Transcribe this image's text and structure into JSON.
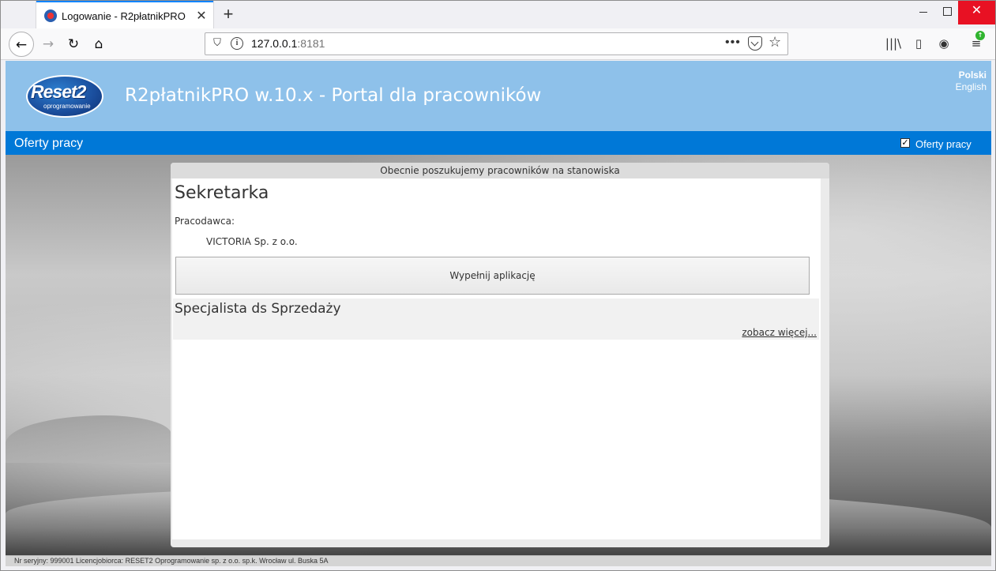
{
  "browser": {
    "tab_title": "Logowanie - R2płatnikPRO",
    "tab_close": "✕",
    "new_tab": "+",
    "close": "✕",
    "url_host": "127.0.0.1",
    "url_port": ":8181",
    "url_more": "•••",
    "star": "☆",
    "back": "←",
    "forward": "→",
    "reload": "↻",
    "home": "⌂",
    "shield": "⛉",
    "info": "i",
    "library": "|||\\",
    "sidebar": "▯",
    "account": "◉",
    "menu": "≡",
    "update": "↑"
  },
  "header": {
    "logo_text": "Reset2",
    "logo_sub": "oprogramowanie",
    "title": "R2płatnikPRO w.10.x - Portal dla pracowników",
    "lang_pl": "Polski",
    "lang_en": "English"
  },
  "menubar": {
    "title": "Oferty pracy",
    "checkbox_label": "Oferty pracy",
    "checkbox_mark": "✓"
  },
  "panel": {
    "heading": "Obecnie poszukujemy pracowników na stanowiska",
    "job1": {
      "title": "Sekretarka",
      "employer_label": "Pracodawca:",
      "employer_name": "VICTORIA Sp. z o.o.",
      "apply_label": "Wypełnij aplikację"
    },
    "job2": {
      "title": "Specjalista ds Sprzedaży",
      "more_label": "zobacz więcej..."
    }
  },
  "footer": {
    "text": "Nr seryjny: 999001 Licencjobiorca: RESET2 Oprogramowanie sp. z o.o. sp.k. Wrocław ul. Buska 5A"
  }
}
